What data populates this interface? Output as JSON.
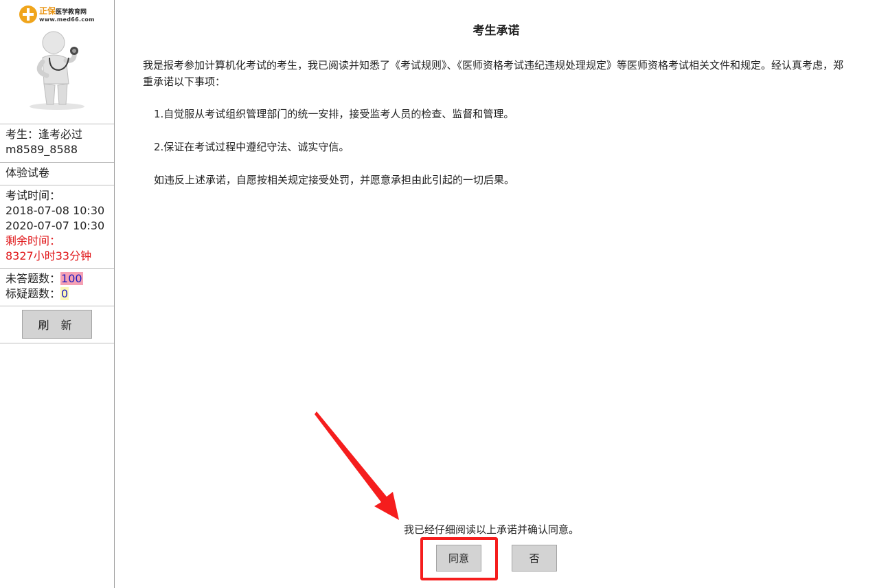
{
  "logo": {
    "brand": "正保",
    "name": "医学教育网",
    "url": "www.med66.com",
    "icon": "medical-logo-icon"
  },
  "sidebar": {
    "candidate_label": "考生：逢考必过",
    "candidate_id": "m8589_8588",
    "paper_name": "体验试卷",
    "exam_time_label": "考试时间：",
    "exam_start": "2018-07-08 10:30",
    "exam_end": "2020-07-07 10:30",
    "remaining_label": "剩余时间：",
    "remaining_value": "8327小时33分钟",
    "unanswered_label": "未答题数：",
    "unanswered_count": "100",
    "flagged_label": "标疑题数：",
    "flagged_count": "0",
    "refresh_button": "刷 新"
  },
  "pledge": {
    "title": "考生承诺",
    "intro": "我是报考参加计算机化考试的考生，我已阅读并知悉了《考试规则》、《医师资格考试违纪违规处理规定》等医师资格考试相关文件和规定。经认真考虑，郑重承诺以下事项：",
    "item1": "1.自觉服从考试组织管理部门的统一安排，接受监考人员的检查、监督和管理。",
    "item2": "2.保证在考试过程中遵纪守法、诚实守信。",
    "closing": "如违反上述承诺，自愿按相关规定接受处罚，并愿意承担由此引起的一切后果。",
    "confirm_text": "我已经仔细阅读以上承诺并确认同意。",
    "agree_button": "同意",
    "decline_button": "否"
  },
  "colors": {
    "accent_red": "#e0171a",
    "annotation_red": "#f51d1d",
    "logo_orange": "#f0a51c",
    "unanswered_badge": "#f5a0b4",
    "flagged_badge": "#fbf7b8",
    "button_gray": "#d3d3d3"
  }
}
